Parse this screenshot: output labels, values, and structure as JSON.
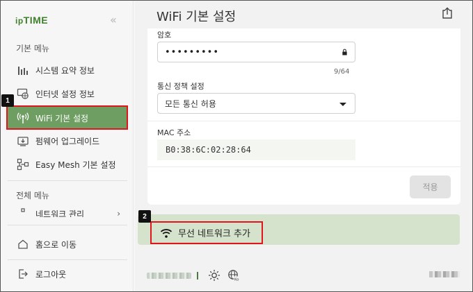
{
  "sidebar": {
    "logo": "ipTIME",
    "logo_prefix": "ip",
    "logo_main": "TIME",
    "collapse_glyph": "«",
    "section_basic": "기본 메뉴",
    "items": [
      {
        "label": "시스템 요약 정보",
        "icon": "bar-chart-icon"
      },
      {
        "label": "인터넷 설정 정보",
        "icon": "globe-monitor-icon"
      },
      {
        "label": "WiFi 기본 설정",
        "icon": "wifi-antenna-icon",
        "active": true
      },
      {
        "label": "펌웨어 업그레이드",
        "icon": "firmware-icon"
      },
      {
        "label": "Easy Mesh 기본 설정",
        "icon": "mesh-icon"
      }
    ],
    "section_all": "전체 메뉴",
    "partial_item": "네트워크 관리",
    "home_label": "홈으로 이동",
    "logout_label": "로그아웃"
  },
  "main": {
    "title": "WiFi 기본 설정",
    "password_label": "암호",
    "password_value": "•••••••••",
    "password_counter": "9/64",
    "policy_label": "통신 정책 설정",
    "policy_value": "모든 통신 허용",
    "mac_label": "MAC 주소",
    "mac_value": "B0:38:6C:02:28:64",
    "apply_label": "적용",
    "add_wireless_label": "무선 네트워크 추가"
  },
  "annotations": {
    "badge1": "1",
    "badge2": "2",
    "highlight_color": "#e0141d"
  },
  "colors": {
    "accent": "#6e9e62",
    "brand": "#3f7f2e",
    "add_bar": "#d5e3cc"
  }
}
